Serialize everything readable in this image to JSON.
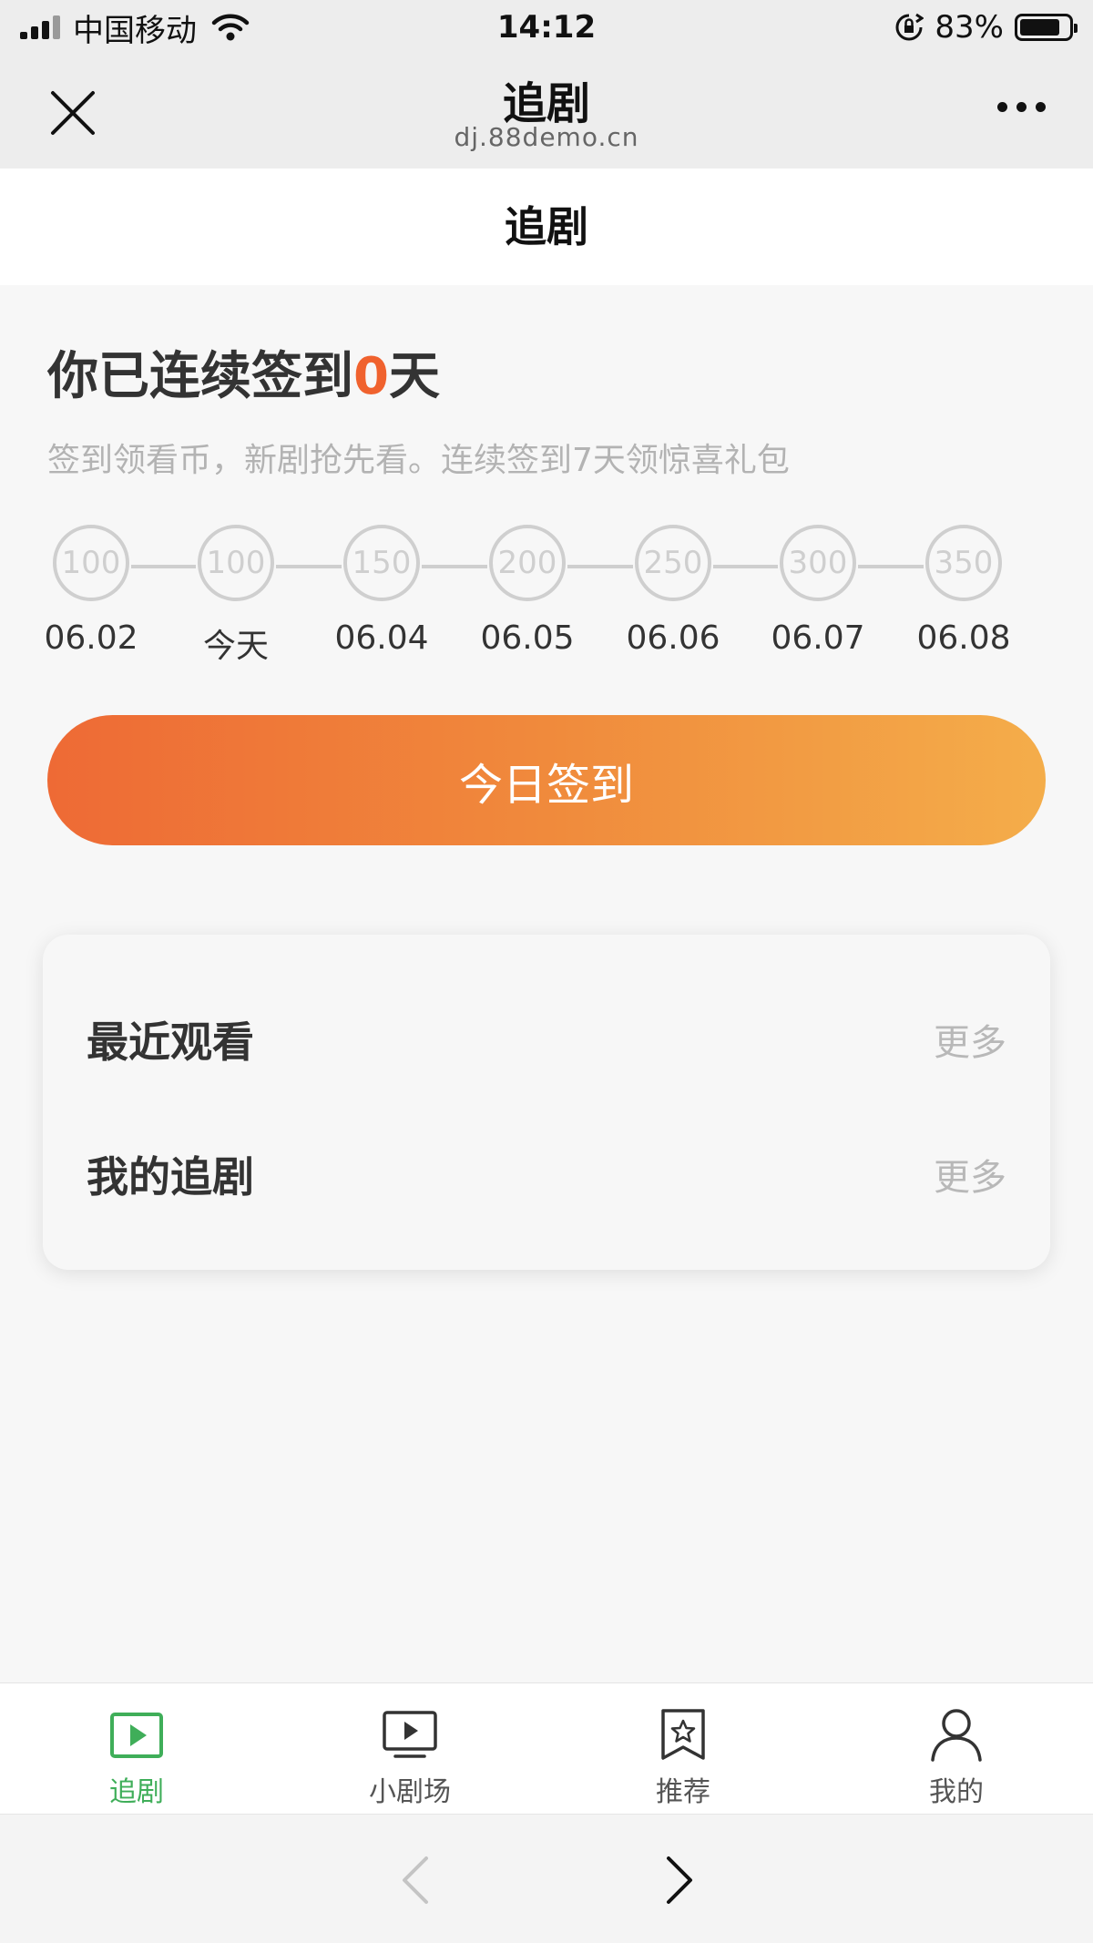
{
  "status_bar": {
    "carrier": "中国移动",
    "time": "14:12",
    "battery": "83%",
    "battery_level": 0.83
  },
  "title_bar": {
    "title": "追剧",
    "domain": "dj.88demo.cn"
  },
  "page": {
    "header_title": "追剧"
  },
  "checkin": {
    "title_prefix": "你已连续签到",
    "streak_count": "0",
    "title_suffix": "天",
    "description": "签到领看币，新剧抢先看。连续签到7天领惊喜礼包",
    "days": [
      {
        "coins": "100",
        "label": "06.02"
      },
      {
        "coins": "100",
        "label": "今天"
      },
      {
        "coins": "150",
        "label": "06.04"
      },
      {
        "coins": "200",
        "label": "06.05"
      },
      {
        "coins": "250",
        "label": "06.06"
      },
      {
        "coins": "300",
        "label": "06.07"
      },
      {
        "coins": "350",
        "label": "06.08"
      }
    ],
    "button_label": "今日签到"
  },
  "sections": {
    "recent": {
      "label": "最近观看",
      "more": "更多"
    },
    "following": {
      "label": "我的追剧",
      "more": "更多"
    }
  },
  "tab_bar": {
    "tabs": [
      {
        "label": "追剧",
        "icon": "play-square-icon",
        "active": true
      },
      {
        "label": "小剧场",
        "icon": "tv-icon",
        "active": false
      },
      {
        "label": "推荐",
        "icon": "bookmark-star-icon",
        "active": false
      },
      {
        "label": "我的",
        "icon": "user-icon",
        "active": false
      }
    ]
  },
  "colors": {
    "accent": "#f0622e",
    "active_tab": "#3fae59",
    "button_gradient_start": "#ee6a35",
    "button_gradient_end": "#f4ad4a"
  }
}
